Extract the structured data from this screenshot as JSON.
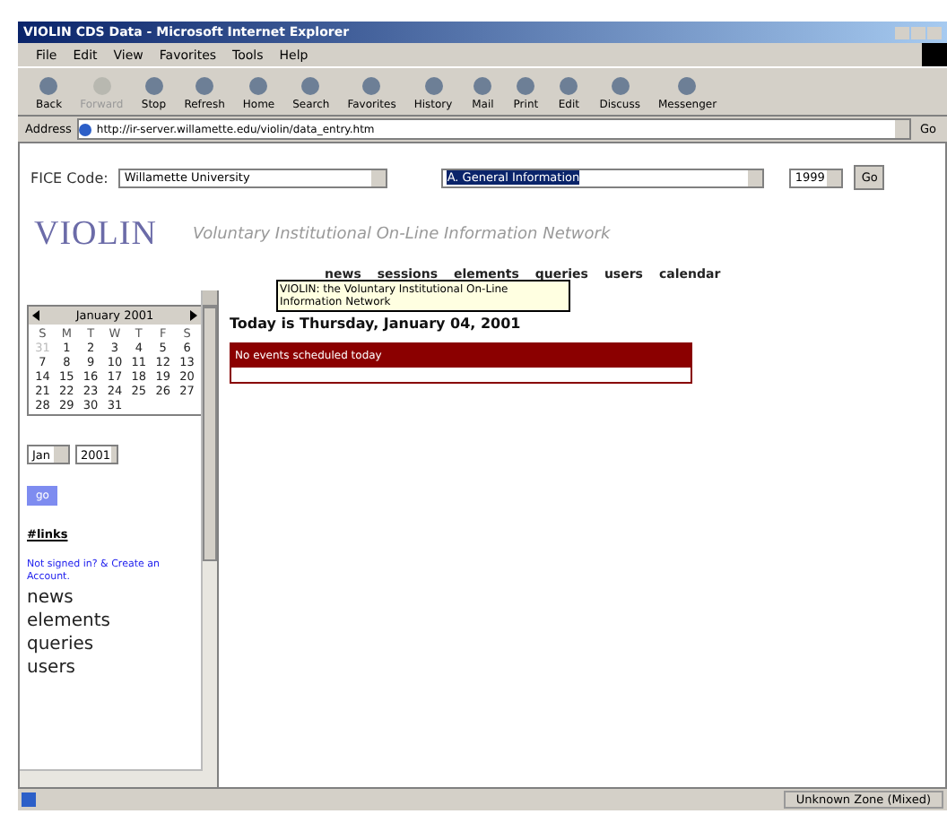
{
  "window": {
    "title": "VIOLIN CDS Data - Microsoft Internet Explorer"
  },
  "menu": [
    "File",
    "Edit",
    "View",
    "Favorites",
    "Tools",
    "Help"
  ],
  "toolbar": [
    {
      "label": "Back",
      "disabled": false
    },
    {
      "label": "Forward",
      "disabled": true
    },
    {
      "label": "Stop",
      "disabled": false
    },
    {
      "label": "Refresh",
      "disabled": false
    },
    {
      "label": "Home",
      "disabled": false
    },
    {
      "label": "Search",
      "disabled": false
    },
    {
      "label": "Favorites",
      "disabled": false
    },
    {
      "label": "History",
      "disabled": false
    },
    {
      "label": "Mail",
      "disabled": false
    },
    {
      "label": "Print",
      "disabled": false
    },
    {
      "label": "Edit",
      "disabled": false
    },
    {
      "label": "Discuss",
      "disabled": false
    },
    {
      "label": "Messenger",
      "disabled": false
    }
  ],
  "address": {
    "label": "Address",
    "value": "http://ir-server.willamette.edu/violin/data_entry.htm",
    "go": "Go"
  },
  "filter": {
    "label": "FICE Code:",
    "institution": "Willamette University",
    "section": "A. General Information",
    "year": "1999",
    "button": "Go"
  },
  "header": {
    "logo": "VIOLIN",
    "tagline": "Voluntary Institutional On-Line Information Network"
  },
  "nav": [
    "news",
    "sessions",
    "elements",
    "queries",
    "users",
    "calendar"
  ],
  "tooltip": "VIOLIN: the Voluntary Institutional On-Line Information Network",
  "today": "Today is Thursday, January 04, 2001",
  "events": {
    "title": "No events scheduled today"
  },
  "calendar": {
    "month": "January 2001",
    "weekdays": [
      "S",
      "M",
      "T",
      "W",
      "T",
      "F",
      "S"
    ],
    "weeks": [
      [
        {
          "d": "31",
          "other": true
        },
        {
          "d": "1",
          "other": false
        },
        {
          "d": "2",
          "other": false
        },
        {
          "d": "3",
          "other": false
        },
        {
          "d": "4",
          "other": false
        },
        {
          "d": "5",
          "other": false
        },
        {
          "d": "6",
          "other": false
        }
      ],
      [
        {
          "d": "7",
          "other": false
        },
        {
          "d": "8",
          "other": false
        },
        {
          "d": "9",
          "other": false
        },
        {
          "d": "10",
          "other": false
        },
        {
          "d": "11",
          "other": false
        },
        {
          "d": "12",
          "other": false
        },
        {
          "d": "13",
          "other": false
        }
      ],
      [
        {
          "d": "14",
          "other": false
        },
        {
          "d": "15",
          "other": false
        },
        {
          "d": "16",
          "other": false
        },
        {
          "d": "17",
          "other": false
        },
        {
          "d": "18",
          "other": false
        },
        {
          "d": "19",
          "other": false
        },
        {
          "d": "20",
          "other": false
        }
      ],
      [
        {
          "d": "21",
          "other": false
        },
        {
          "d": "22",
          "other": false
        },
        {
          "d": "23",
          "other": false
        },
        {
          "d": "24",
          "other": false
        },
        {
          "d": "25",
          "other": false
        },
        {
          "d": "26",
          "other": false
        },
        {
          "d": "27",
          "other": false
        }
      ],
      [
        {
          "d": "28",
          "other": false
        },
        {
          "d": "29",
          "other": false
        },
        {
          "d": "30",
          "other": false
        },
        {
          "d": "31",
          "other": false
        }
      ]
    ]
  },
  "sidebar": {
    "month": "Jan",
    "year": "2001",
    "button": "go",
    "links_heading": "#links",
    "signin": "Not signed in? & Create an Account.",
    "items": [
      "news",
      "elements",
      "queries",
      "users"
    ]
  },
  "status_bar": {
    "zone": "Unknown Zone (Mixed)"
  }
}
